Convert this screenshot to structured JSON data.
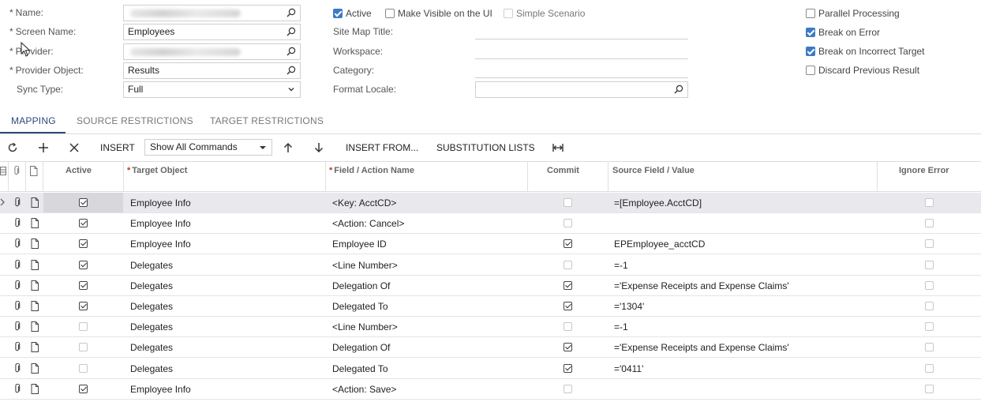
{
  "form": {
    "name_label": "Name:",
    "screen_name_label": "Screen Name:",
    "screen_name_value": "Employees",
    "provider_label": "Provider:",
    "provider_object_label": "Provider Object:",
    "provider_object_value": "Results",
    "sync_type_label": "Sync Type:",
    "sync_type_value": "Full",
    "active_label": "Active",
    "make_visible_label": "Make Visible on the UI",
    "simple_scenario_label": "Simple Scenario",
    "site_map_title_label": "Site Map Title:",
    "workspace_label": "Workspace:",
    "category_label": "Category:",
    "format_locale_label": "Format Locale:",
    "parallel_processing_label": "Parallel Processing",
    "break_on_error_label": "Break on Error",
    "break_on_incorrect_target_label": "Break on Incorrect Target",
    "discard_previous_result_label": "Discard Previous Result",
    "required_mark": "*"
  },
  "tabs": [
    "MAPPING",
    "SOURCE RESTRICTIONS",
    "TARGET RESTRICTIONS"
  ],
  "toolbar": {
    "insert_label": "INSERT",
    "filter_value": "Show All Commands",
    "insert_from_label": "INSERT FROM...",
    "substitution_lists_label": "SUBSTITUTION LISTS"
  },
  "grid": {
    "columns": {
      "active": "Active",
      "target_object": "Target Object",
      "field_action": "Field / Action Name",
      "commit": "Commit",
      "source_field": "Source Field / Value",
      "ignore_error": "Ignore Error"
    },
    "rows": [
      {
        "active": true,
        "target": "Employee Info",
        "field": "<Key: AcctCD>",
        "commit": false,
        "commit_disabled": true,
        "source": "=[Employee.AcctCD]",
        "ignore": false
      },
      {
        "active": true,
        "target": "Employee Info",
        "field": "<Action: Cancel>",
        "commit": false,
        "commit_disabled": true,
        "source": "",
        "ignore": false
      },
      {
        "active": true,
        "target": "Employee Info",
        "field": "Employee ID",
        "commit": true,
        "commit_disabled": false,
        "source": "EPEmployee_acctCD",
        "ignore": false
      },
      {
        "active": true,
        "target": "Delegates",
        "field": "<Line Number>",
        "commit": false,
        "commit_disabled": true,
        "source": "=-1",
        "ignore": false
      },
      {
        "active": true,
        "target": "Delegates",
        "field": "Delegation Of",
        "commit": true,
        "commit_disabled": false,
        "source": "='Expense Receipts and Expense Claims'",
        "ignore": false
      },
      {
        "active": true,
        "target": "Delegates",
        "field": "Delegated To",
        "commit": true,
        "commit_disabled": false,
        "source": "='1304'",
        "ignore": false
      },
      {
        "active": false,
        "target": "Delegates",
        "field": "<Line Number>",
        "commit": false,
        "commit_disabled": true,
        "source": "=-1",
        "ignore": false
      },
      {
        "active": false,
        "target": "Delegates",
        "field": "Delegation Of",
        "commit": true,
        "commit_disabled": false,
        "source": "='Expense Receipts and Expense Claims'",
        "ignore": false
      },
      {
        "active": false,
        "target": "Delegates",
        "field": "Delegated To",
        "commit": true,
        "commit_disabled": false,
        "source": "='0411'",
        "ignore": false
      },
      {
        "active": true,
        "target": "Employee Info",
        "field": "<Action: Save>",
        "commit": false,
        "commit_disabled": true,
        "source": "",
        "ignore": false
      }
    ]
  },
  "icons": {
    "lookup": "magnifier-icon",
    "refresh": "refresh-icon",
    "add": "plus-icon",
    "delete": "close-icon",
    "up": "arrow-up-icon",
    "down": "arrow-down-icon",
    "fit": "fit-columns-icon",
    "attach": "paperclip-icon",
    "note": "note-icon"
  },
  "colors": {
    "accent": "#3d7ac5",
    "tab_active": "#2b4c7a",
    "required": "#c0392b",
    "selected_row": "#e9e9ed"
  }
}
